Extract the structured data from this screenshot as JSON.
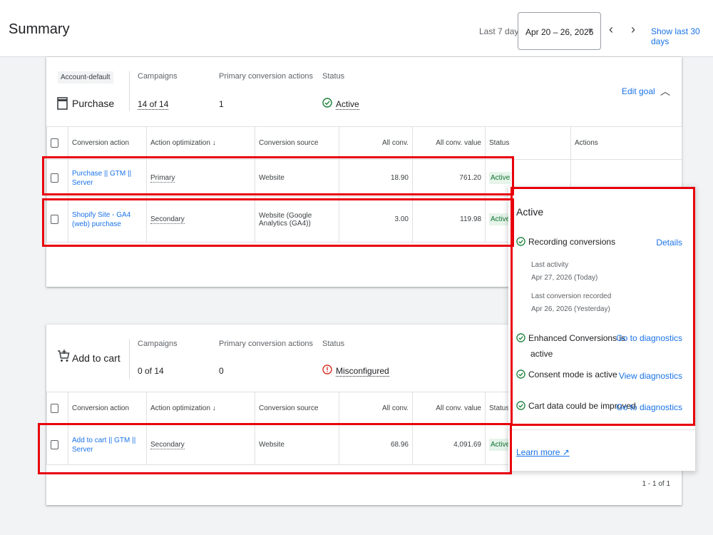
{
  "header": {
    "title": "Summary",
    "range_label": "Last 7 days",
    "date_range": "Apr 20 – 26, 2026",
    "show_last": "Show last 30 days"
  },
  "goal_purchase": {
    "chip": "Account-default",
    "name": "Purchase",
    "campaigns_label": "Campaigns",
    "campaigns_value": "14 of 14",
    "primary_label": "Primary conversion actions",
    "primary_value": "1",
    "status_label": "Status",
    "status_value": "Active",
    "edit_goal": "Edit goal"
  },
  "goal_cart": {
    "name": "Add to cart",
    "campaigns_label": "Campaigns",
    "campaigns_value": "0 of 14",
    "primary_label": "Primary conversion actions",
    "primary_value": "0",
    "status_label": "Status",
    "status_value": "Misconfigured"
  },
  "columns": {
    "action": "Conversion action",
    "optimization": "Action optimization",
    "source": "Conversion source",
    "all_conv": "All conv.",
    "all_conv_value": "All conv. value",
    "status": "Status",
    "actions": "Actions"
  },
  "table1_rows": [
    {
      "action": "Purchase || GTM || Server",
      "optimization": "Primary",
      "source": "Website",
      "all_conv": "18.90",
      "value": "761.20",
      "status": "Active"
    },
    {
      "action": "Shopify Site - GA4 (web) purchase",
      "optimization": "Secondary",
      "source": "Website (Google Analytics (GA4))",
      "all_conv": "3.00",
      "value": "119.98",
      "status": "Active"
    }
  ],
  "table2_rows": [
    {
      "action": "Add to cart || GTM || Server",
      "optimization": "Secondary",
      "source": "Website",
      "all_conv": "68.96",
      "value": "4,091.69",
      "status": "Active"
    }
  ],
  "pager": "1 - 1 of 1",
  "popup": {
    "title": "Active",
    "recording": "Recording conversions",
    "details": "Details",
    "last_activity_label": "Last activity",
    "last_activity_value": "Apr 27, 2026 (Today)",
    "last_conv_label": "Last conversion recorded",
    "last_conv_value": "Apr 26, 2026 (Yesterday)",
    "enhanced_1": "Enhanced Conversions is",
    "enhanced_2": "active",
    "go_diag_1": "Go to diagnostics",
    "consent": "Consent mode is active",
    "view_diag": "View diagnostics",
    "cart_data": "Cart data could be improved",
    "go_diag_2": "Go to diagnostics",
    "learn_more": "Learn more"
  },
  "colors": {
    "accent": "#1a73e8",
    "success": "#188038",
    "error": "#d93025",
    "highlight": "#e8000b"
  }
}
